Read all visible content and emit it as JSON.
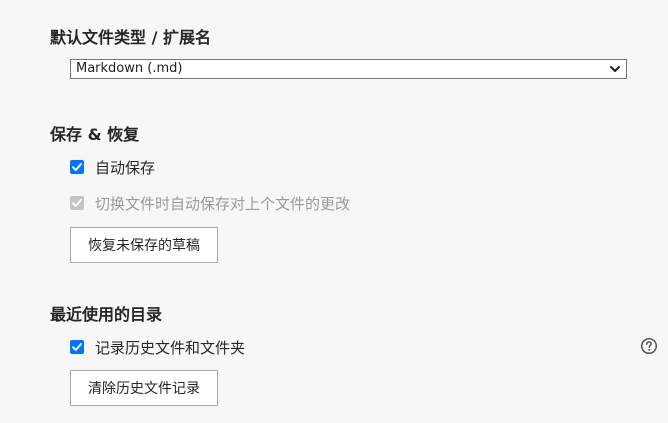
{
  "default_file_type": {
    "title": "默认文件类型 / 扩展名",
    "selected": "Markdown (.md)"
  },
  "save_restore": {
    "title": "保存 & 恢复",
    "auto_save_label": "自动保存",
    "auto_save_checked": true,
    "auto_save_on_switch_label": "切换文件时自动保存对上个文件的更改",
    "auto_save_on_switch_checked": true,
    "auto_save_on_switch_disabled": true,
    "restore_button": "恢复未保存的草稿"
  },
  "recent": {
    "title": "最近使用的目录",
    "record_history_label": "记录历史文件和文件夹",
    "record_history_checked": true,
    "clear_button": "清除历史文件记录"
  },
  "icons": {
    "dropdown": "chevron-down-icon",
    "checkmark": "checkmark-icon",
    "help": "help-circle-icon"
  },
  "colors": {
    "accent": "#0075ff",
    "disabled": "#c4c4c4"
  }
}
